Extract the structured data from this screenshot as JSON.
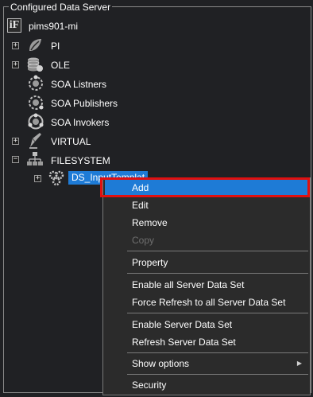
{
  "panel": {
    "title": "Configured Data Server"
  },
  "tree": {
    "root": {
      "icon": "iF-logo-icon",
      "logo_text": "iF",
      "label": "pims901-mi"
    },
    "nodes": [
      {
        "label": "PI",
        "icon": "pi-leaf-icon",
        "expander": "+"
      },
      {
        "label": "OLE",
        "icon": "ole-database-icon",
        "expander": "+"
      },
      {
        "label": "SOA Listners",
        "icon": "soa-listners-icon",
        "expander": ""
      },
      {
        "label": "SOA Publishers",
        "icon": "soa-publishers-icon",
        "expander": ""
      },
      {
        "label": "SOA Invokers",
        "icon": "soa-invokers-icon",
        "expander": ""
      },
      {
        "label": "VIRTUAL",
        "icon": "virtual-pen-icon",
        "expander": "+"
      },
      {
        "label": "FILESYSTEM",
        "icon": "filesystem-hierarchy-icon",
        "expander": "−"
      }
    ],
    "child": {
      "label": "DS_InputTemplat",
      "icon": "gears-icon",
      "expander": "+"
    }
  },
  "context_menu": {
    "items": [
      {
        "label": "Add",
        "state": "highlighted"
      },
      {
        "label": "Edit",
        "state": "normal"
      },
      {
        "label": "Remove",
        "state": "normal"
      },
      {
        "label": "Copy",
        "state": "disabled"
      },
      {
        "label": "Property",
        "state": "normal"
      },
      {
        "label": "Enable all Server Data Set",
        "state": "normal"
      },
      {
        "label": "Force Refresh to all Server Data Set",
        "state": "normal"
      },
      {
        "label": "Enable Server Data Set",
        "state": "normal"
      },
      {
        "label": "Refresh Server Data Set",
        "state": "normal"
      },
      {
        "label": "Show options",
        "state": "submenu",
        "arrow": "▶"
      },
      {
        "label": "Security",
        "state": "normal"
      }
    ]
  },
  "colors": {
    "background": "#202124",
    "selection": "#1e7bd6",
    "annotation_box": "#e01010",
    "disabled_text": "#6f6f6f"
  }
}
